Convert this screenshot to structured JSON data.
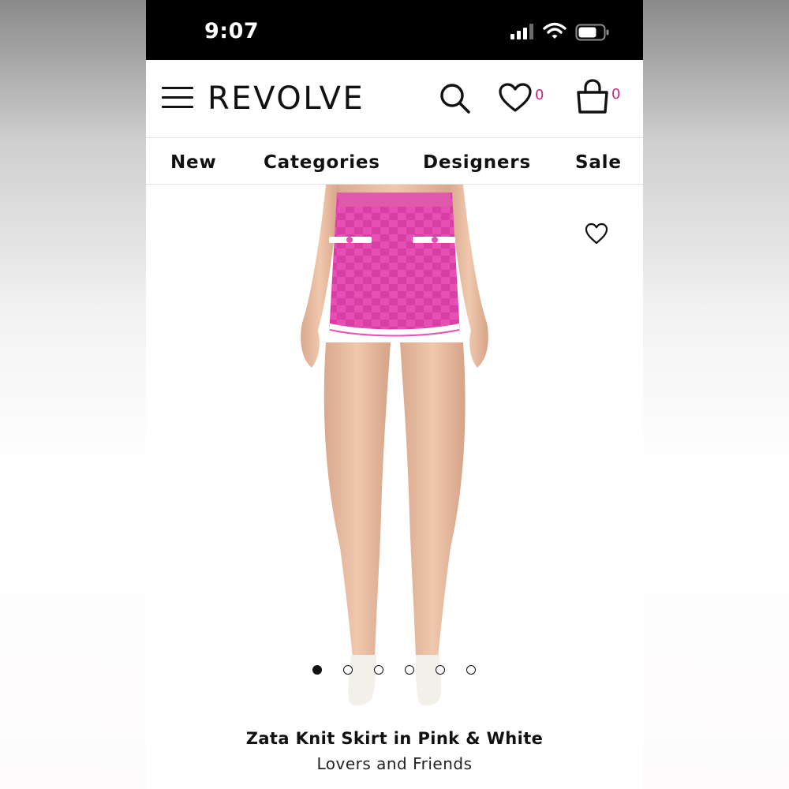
{
  "status_bar": {
    "time": "9:07",
    "signal_icon": "cellular-signal-icon",
    "wifi_icon": "wifi-icon",
    "battery_icon": "battery-icon"
  },
  "header": {
    "logo": "REVOLVE",
    "menu_icon": "hamburger-menu-icon",
    "search_icon": "search-icon",
    "wishlist_icon": "heart-icon",
    "wishlist_count": "0",
    "bag_icon": "shopping-bag-icon",
    "bag_count": "0",
    "accent_color": "#c0267f"
  },
  "nav": {
    "items": [
      "New",
      "Categories",
      "Designers",
      "Sale"
    ]
  },
  "product": {
    "name": "Zata Knit Skirt in Pink & White",
    "brand": "Lovers and Friends",
    "image_count": 6,
    "active_image": 1,
    "favorite_icon": "heart-outline-icon",
    "skirt_color": "#e84fb4"
  }
}
